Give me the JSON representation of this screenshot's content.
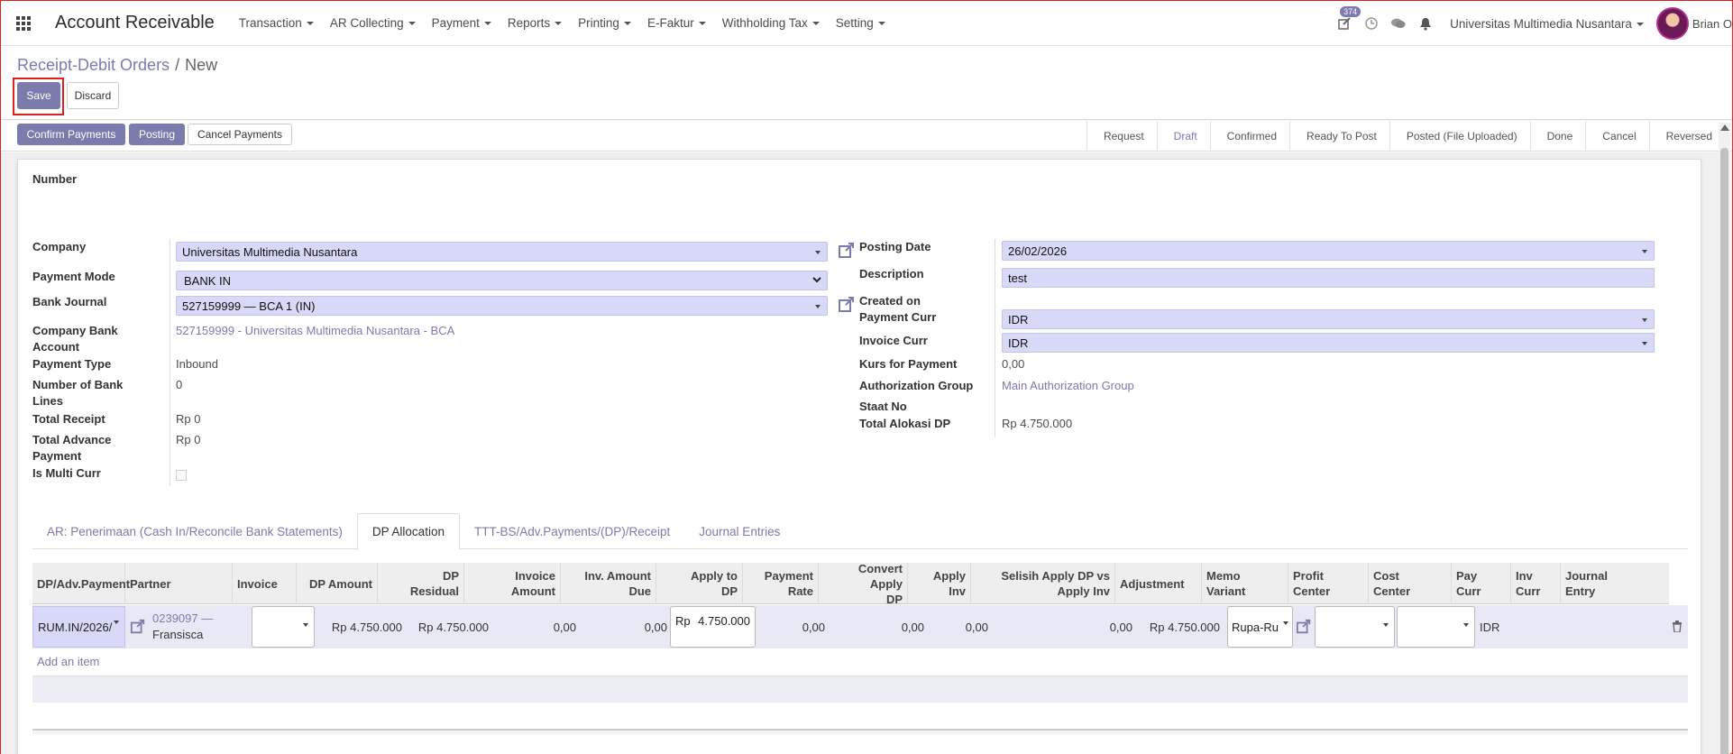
{
  "app": {
    "title": "Account Receivable"
  },
  "menu": [
    {
      "label": "Transaction"
    },
    {
      "label": "AR Collecting"
    },
    {
      "label": "Payment"
    },
    {
      "label": "Reports"
    },
    {
      "label": "Printing"
    },
    {
      "label": "E-Faktur"
    },
    {
      "label": "Withholding Tax"
    },
    {
      "label": "Setting"
    }
  ],
  "navbar": {
    "activity_count": "374",
    "company": "Universitas Multimedia Nusantara",
    "user": "Brian O"
  },
  "breadcrumb": {
    "parent": "Receipt-Debit Orders",
    "current": "New"
  },
  "buttons": {
    "save": "Save",
    "discard": "Discard",
    "confirm_payments": "Confirm Payments",
    "posting": "Posting",
    "cancel_payments": "Cancel Payments"
  },
  "stages": [
    "Request",
    "Draft",
    "Confirmed",
    "Ready To Post",
    "Posted (File Uploaded)",
    "Done",
    "Cancel",
    "Reversed"
  ],
  "active_stage": "Draft",
  "form": {
    "number_label": "Number",
    "left": {
      "company_label": "Company",
      "company_value": "Universitas Multimedia Nusantara",
      "payment_mode_label": "Payment Mode",
      "payment_mode_value": "BANK IN",
      "bank_journal_label": "Bank Journal",
      "bank_journal_value": "527159999 — BCA 1 (IN)",
      "company_bank_label_1": "Company Bank",
      "company_bank_label_2": "Account",
      "company_bank_value": "527159999 - Universitas Multimedia Nusantara - BCA",
      "payment_type_label": "Payment Type",
      "payment_type_value": "Inbound",
      "num_bank_lines_label_1": "Number of Bank",
      "num_bank_lines_label_2": "Lines",
      "num_bank_lines_value": "0",
      "total_receipt_label": "Total Receipt",
      "total_receipt_value": "Rp 0",
      "total_advance_label_1": "Total Advance",
      "total_advance_label_2": "Payment",
      "total_advance_value": "Rp 0",
      "is_multi_curr_label": "Is Multi Curr",
      "is_multi_curr_value": false
    },
    "right": {
      "posting_date_label": "Posting Date",
      "posting_date_value": "26/02/2026",
      "description_label": "Description",
      "description_value": "test",
      "created_on_label": "Created on",
      "payment_curr_label": "Payment Curr",
      "payment_curr_value": "IDR",
      "invoice_curr_label": "Invoice Curr",
      "invoice_curr_value": "IDR",
      "kurs_label": "Kurs for Payment",
      "kurs_value": "0,00",
      "auth_group_label": "Authorization Group",
      "auth_group_value": "Main Authorization Group",
      "staat_no_label": "Staat No",
      "total_alokasi_label": "Total Alokasi DP",
      "total_alokasi_value": "Rp 4.750.000"
    }
  },
  "tabs": [
    {
      "label": "AR: Penerimaan (Cash In/Reconcile Bank Statements)"
    },
    {
      "label": "DP Allocation"
    },
    {
      "label": "TTT-BS/Adv.Payments/(DP)/Receipt"
    },
    {
      "label": "Journal Entries"
    }
  ],
  "active_tab": "DP Allocation",
  "grid": {
    "columns": {
      "dp_adv": "DP/Adv.Payment",
      "partner": "Partner",
      "invoice": "Invoice",
      "dp_amount": "DP Amount",
      "dp_residual_1": "DP",
      "dp_residual_2": "Residual",
      "invoice_amount_1": "Invoice",
      "invoice_amount_2": "Amount",
      "inv_amount_due_1": "Inv. Amount",
      "inv_amount_due_2": "Due",
      "apply_to_dp_1": "Apply to",
      "apply_to_dp_2": "DP",
      "payment_rate_1": "Payment",
      "payment_rate_2": "Rate",
      "convert_apply_1": "Convert Apply",
      "convert_apply_2": "DP",
      "apply_inv_1": "Apply",
      "apply_inv_2": "Inv",
      "selisih_1": "Selisih Apply DP vs",
      "selisih_2": "Apply Inv",
      "adjustment": "Adjustment",
      "memo_1": "Memo",
      "memo_2": "Variant",
      "profit_1": "Profit",
      "profit_2": "Center",
      "cost_1": "Cost",
      "cost_2": "Center",
      "pay_curr_1": "Pay",
      "pay_curr_2": "Curr",
      "inv_curr_1": "Inv",
      "inv_curr_2": "Curr",
      "journal_1": "Journal",
      "journal_2": "Entry"
    },
    "row": {
      "dp_adv": "RUM.IN/2026/",
      "partner_1": "0239097 —",
      "partner_2": "Fransisca",
      "dp_amount": "Rp 4.750.000",
      "dp_residual": "Rp 4.750.000",
      "invoice_amount": "0,00",
      "inv_amount_due": "0,00",
      "apply_to_dp_cur": "Rp",
      "apply_to_dp_val": "4.750.000",
      "payment_rate": "0,00",
      "convert_apply": "0,00",
      "apply_inv": "0,00",
      "selisih": "0,00",
      "adjustment": "Rp 4.750.000",
      "memo": "Rupa-Ru",
      "pay_curr": "IDR"
    },
    "add_item": "Add an item"
  },
  "colors": {
    "accent": "#7c7bad",
    "input_bg": "#d8d8f8",
    "highlight_border": "#e02020"
  }
}
